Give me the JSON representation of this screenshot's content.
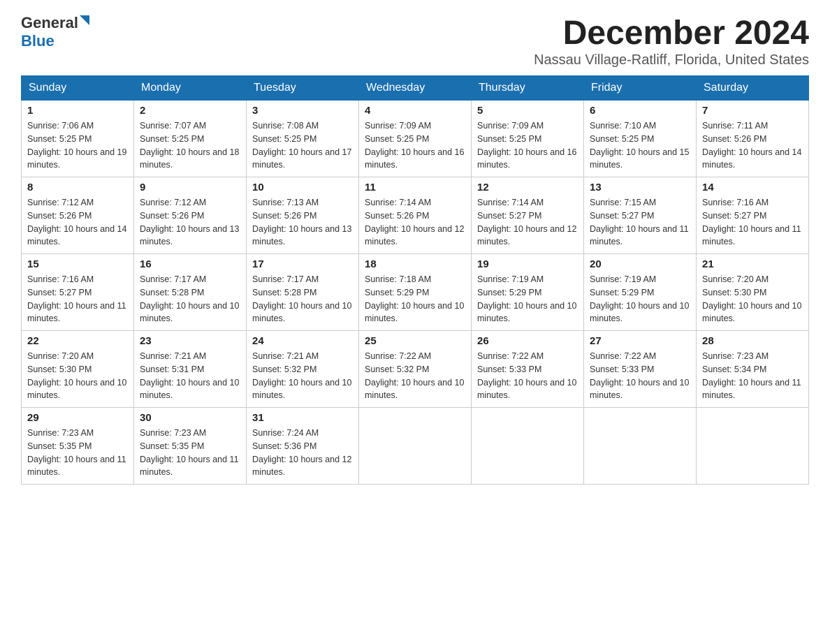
{
  "header": {
    "logo_general": "General",
    "logo_blue": "Blue",
    "month_title": "December 2024",
    "location": "Nassau Village-Ratliff, Florida, United States"
  },
  "days_of_week": [
    "Sunday",
    "Monday",
    "Tuesday",
    "Wednesday",
    "Thursday",
    "Friday",
    "Saturday"
  ],
  "weeks": [
    [
      {
        "day": "1",
        "sunrise": "7:06 AM",
        "sunset": "5:25 PM",
        "daylight": "10 hours and 19 minutes."
      },
      {
        "day": "2",
        "sunrise": "7:07 AM",
        "sunset": "5:25 PM",
        "daylight": "10 hours and 18 minutes."
      },
      {
        "day": "3",
        "sunrise": "7:08 AM",
        "sunset": "5:25 PM",
        "daylight": "10 hours and 17 minutes."
      },
      {
        "day": "4",
        "sunrise": "7:09 AM",
        "sunset": "5:25 PM",
        "daylight": "10 hours and 16 minutes."
      },
      {
        "day": "5",
        "sunrise": "7:09 AM",
        "sunset": "5:25 PM",
        "daylight": "10 hours and 16 minutes."
      },
      {
        "day": "6",
        "sunrise": "7:10 AM",
        "sunset": "5:25 PM",
        "daylight": "10 hours and 15 minutes."
      },
      {
        "day": "7",
        "sunrise": "7:11 AM",
        "sunset": "5:26 PM",
        "daylight": "10 hours and 14 minutes."
      }
    ],
    [
      {
        "day": "8",
        "sunrise": "7:12 AM",
        "sunset": "5:26 PM",
        "daylight": "10 hours and 14 minutes."
      },
      {
        "day": "9",
        "sunrise": "7:12 AM",
        "sunset": "5:26 PM",
        "daylight": "10 hours and 13 minutes."
      },
      {
        "day": "10",
        "sunrise": "7:13 AM",
        "sunset": "5:26 PM",
        "daylight": "10 hours and 13 minutes."
      },
      {
        "day": "11",
        "sunrise": "7:14 AM",
        "sunset": "5:26 PM",
        "daylight": "10 hours and 12 minutes."
      },
      {
        "day": "12",
        "sunrise": "7:14 AM",
        "sunset": "5:27 PM",
        "daylight": "10 hours and 12 minutes."
      },
      {
        "day": "13",
        "sunrise": "7:15 AM",
        "sunset": "5:27 PM",
        "daylight": "10 hours and 11 minutes."
      },
      {
        "day": "14",
        "sunrise": "7:16 AM",
        "sunset": "5:27 PM",
        "daylight": "10 hours and 11 minutes."
      }
    ],
    [
      {
        "day": "15",
        "sunrise": "7:16 AM",
        "sunset": "5:27 PM",
        "daylight": "10 hours and 11 minutes."
      },
      {
        "day": "16",
        "sunrise": "7:17 AM",
        "sunset": "5:28 PM",
        "daylight": "10 hours and 10 minutes."
      },
      {
        "day": "17",
        "sunrise": "7:17 AM",
        "sunset": "5:28 PM",
        "daylight": "10 hours and 10 minutes."
      },
      {
        "day": "18",
        "sunrise": "7:18 AM",
        "sunset": "5:29 PM",
        "daylight": "10 hours and 10 minutes."
      },
      {
        "day": "19",
        "sunrise": "7:19 AM",
        "sunset": "5:29 PM",
        "daylight": "10 hours and 10 minutes."
      },
      {
        "day": "20",
        "sunrise": "7:19 AM",
        "sunset": "5:29 PM",
        "daylight": "10 hours and 10 minutes."
      },
      {
        "day": "21",
        "sunrise": "7:20 AM",
        "sunset": "5:30 PM",
        "daylight": "10 hours and 10 minutes."
      }
    ],
    [
      {
        "day": "22",
        "sunrise": "7:20 AM",
        "sunset": "5:30 PM",
        "daylight": "10 hours and 10 minutes."
      },
      {
        "day": "23",
        "sunrise": "7:21 AM",
        "sunset": "5:31 PM",
        "daylight": "10 hours and 10 minutes."
      },
      {
        "day": "24",
        "sunrise": "7:21 AM",
        "sunset": "5:32 PM",
        "daylight": "10 hours and 10 minutes."
      },
      {
        "day": "25",
        "sunrise": "7:22 AM",
        "sunset": "5:32 PM",
        "daylight": "10 hours and 10 minutes."
      },
      {
        "day": "26",
        "sunrise": "7:22 AM",
        "sunset": "5:33 PM",
        "daylight": "10 hours and 10 minutes."
      },
      {
        "day": "27",
        "sunrise": "7:22 AM",
        "sunset": "5:33 PM",
        "daylight": "10 hours and 10 minutes."
      },
      {
        "day": "28",
        "sunrise": "7:23 AM",
        "sunset": "5:34 PM",
        "daylight": "10 hours and 11 minutes."
      }
    ],
    [
      {
        "day": "29",
        "sunrise": "7:23 AM",
        "sunset": "5:35 PM",
        "daylight": "10 hours and 11 minutes."
      },
      {
        "day": "30",
        "sunrise": "7:23 AM",
        "sunset": "5:35 PM",
        "daylight": "10 hours and 11 minutes."
      },
      {
        "day": "31",
        "sunrise": "7:24 AM",
        "sunset": "5:36 PM",
        "daylight": "10 hours and 12 minutes."
      },
      null,
      null,
      null,
      null
    ]
  ]
}
